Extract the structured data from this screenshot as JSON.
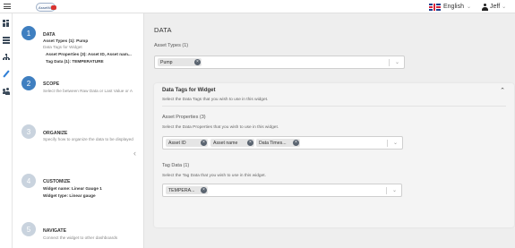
{
  "topbar": {
    "logo_text": "AssetMgr",
    "language": "English",
    "user": "Jeff"
  },
  "rail": {
    "icons": [
      "dashboard-icon",
      "stack-icon",
      "hierarchy-icon",
      "pencil-icon",
      "users-icon"
    ]
  },
  "steps": [
    {
      "number": "1",
      "title": "DATA",
      "lines": [
        "Asset Types (1): Pump",
        "Data Tags for Widget",
        "Asset Properties (3): Asset ID, Asset nam...",
        "Tag Data (1): TEMPERATURE"
      ]
    },
    {
      "number": "2",
      "title": "SCOPE",
      "lines": [
        "Select the between Raw Data or Last Value or A"
      ]
    },
    {
      "number": "3",
      "title": "ORGANIZE",
      "lines": [
        "Specify how to organize the data to be displayed"
      ]
    },
    {
      "number": "4",
      "title": "CUSTOMIZE",
      "lines": [
        "Widget name: Linear Gauge 1",
        "Widget type: Linear gauge"
      ]
    },
    {
      "number": "5",
      "title": "NAVIGATE",
      "lines": [
        "Connect the widget to other dashboards"
      ]
    }
  ],
  "main": {
    "title": "DATA",
    "asset_types": {
      "label": "Asset Types (1)",
      "chips": [
        "Pump"
      ]
    },
    "data_tags": {
      "title": "Data Tags for Widget",
      "subtitle": "Select the Data Tags that you wish to use in this widget.",
      "properties": {
        "label": "Asset Properties (3)",
        "hint": "Select the Data Properties that you wish to use in this widget.",
        "chips": [
          "Asset ID",
          "Asset name",
          "Data Times..."
        ]
      },
      "tag_data": {
        "label": "Tag Data (1)",
        "hint": "Select the Tag Data that you wish to use in this widget.",
        "chips": [
          "TEMPERA..."
        ]
      }
    }
  },
  "colors": {
    "accent": "#3f7fc0",
    "idle_step": "#c9d3de",
    "chip_bg": "#e5e5e5",
    "chip_remove": "#5a6470"
  }
}
